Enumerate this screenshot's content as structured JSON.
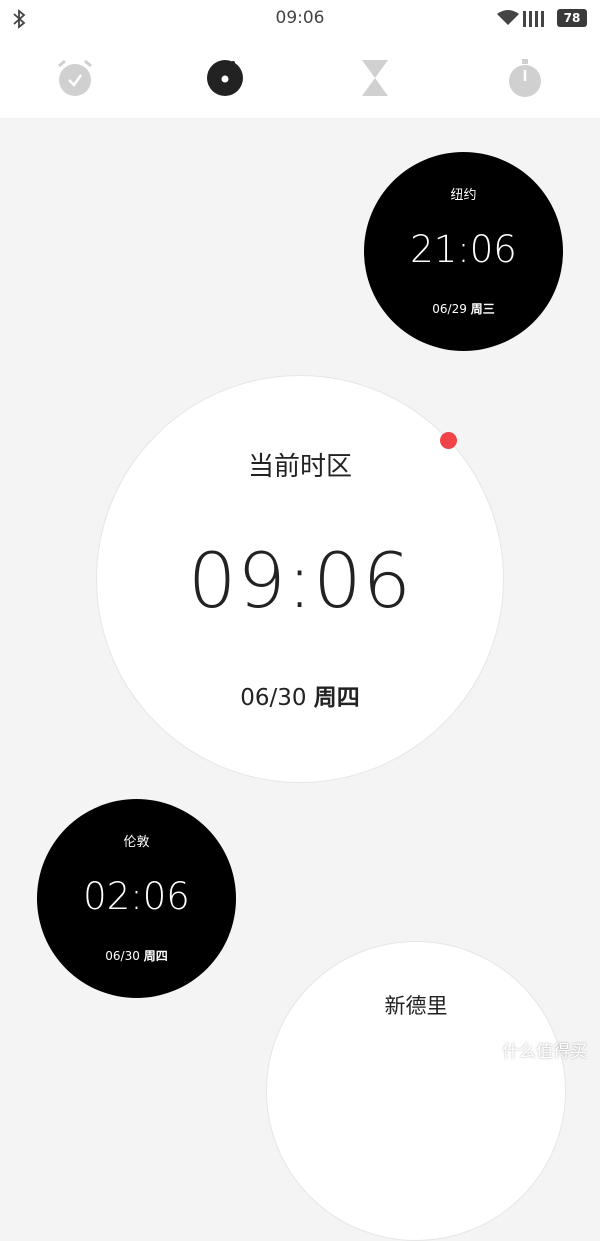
{
  "status_bar": {
    "time": "09:06",
    "battery": "78",
    "icons": [
      "bluetooth-icon",
      "wifi-icon",
      "signal-icon",
      "battery-icon"
    ]
  },
  "tabs": [
    {
      "name": "alarm",
      "icon": "alarm-clock-icon",
      "active": false
    },
    {
      "name": "world-clock",
      "icon": "clock-icon",
      "active": true
    },
    {
      "name": "timer",
      "icon": "hourglass-icon",
      "active": false
    },
    {
      "name": "stopwatch",
      "icon": "stopwatch-icon",
      "active": false
    }
  ],
  "clocks": {
    "new_york": {
      "name": "纽约",
      "time": "21:06",
      "date": "06/29",
      "weekday": "周三"
    },
    "local": {
      "name": "当前时区",
      "time": "09:06",
      "date": "06/30",
      "weekday": "周四"
    },
    "london": {
      "name": "伦敦",
      "time": "02:06",
      "date": "06/30",
      "weekday": "周四"
    },
    "new_delhi": {
      "name": "新德里"
    }
  },
  "colors": {
    "background": "#f4f4f4",
    "dark_circle": "#000000",
    "accent_dot": "#f04249"
  },
  "watermark": "什么值得买"
}
